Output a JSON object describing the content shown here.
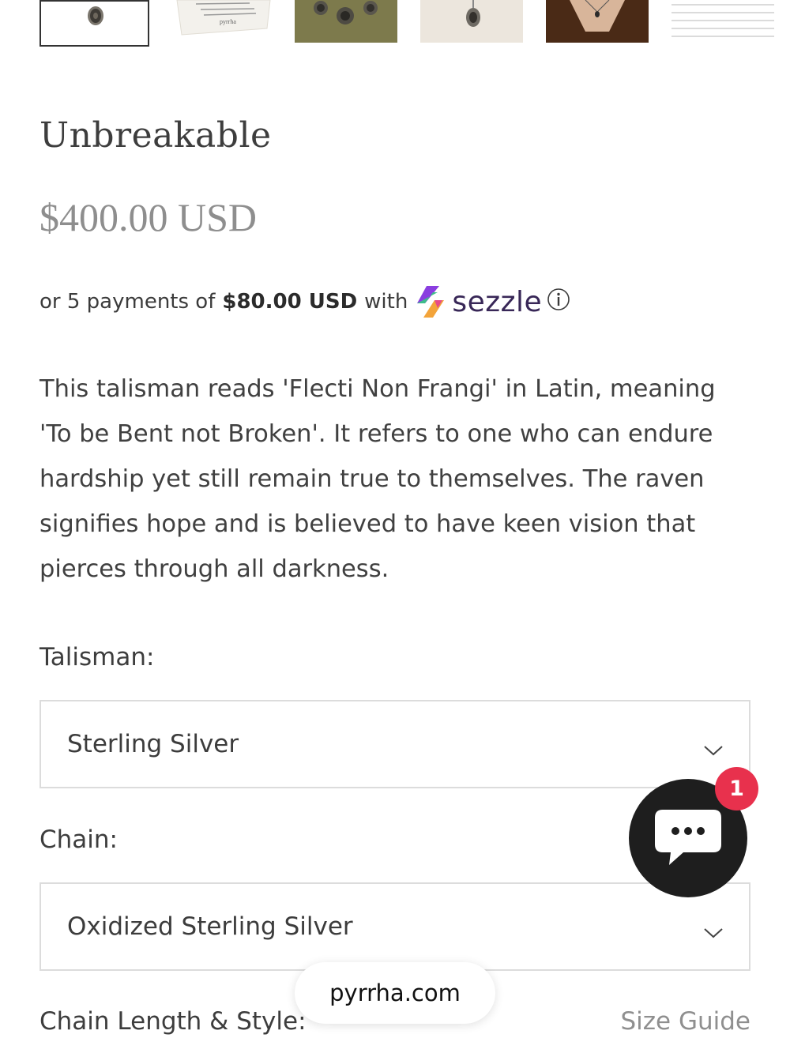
{
  "thumbnails": [
    {
      "name": "pendant-front",
      "selected": true
    },
    {
      "name": "meaning-card",
      "selected": false,
      "card_text": "pyrrha"
    },
    {
      "name": "pendants-on-green",
      "selected": false
    },
    {
      "name": "pendant-on-linen",
      "selected": false
    },
    {
      "name": "worn-on-model",
      "selected": false
    },
    {
      "name": "chain-length-chart",
      "selected": false
    }
  ],
  "product": {
    "title": "Unbreakable",
    "price": "$400.00 USD"
  },
  "sezzle": {
    "prefix": "or 5 payments of",
    "amount": "$80.00 USD",
    "suffix": "with",
    "brand": "sezzle",
    "info_icon": "info-circle-icon"
  },
  "description": "This talisman reads 'Flecti Non Frangi' in Latin, meaning 'To be Bent not Broken'. It refers to one who can endure hardship yet still remain true to themselves. The raven signifies hope and is believed to have keen vision that pierces through all darkness.",
  "options": {
    "talisman_label": "Talisman:",
    "talisman_value": "Sterling Silver",
    "chain_label": "Chain:",
    "chain_value": "Oxidized Sterling Silver",
    "length_label": "Chain Length & Style:",
    "size_guide": "Size Guide"
  },
  "chat": {
    "badge_count": "1",
    "icon": "chat-bubble-icon"
  },
  "browser": {
    "url": "pyrrha.com"
  },
  "colors": {
    "sezzle_purple": "#382757",
    "badge_red": "#e8314d",
    "chat_black": "#1e1e1e"
  }
}
